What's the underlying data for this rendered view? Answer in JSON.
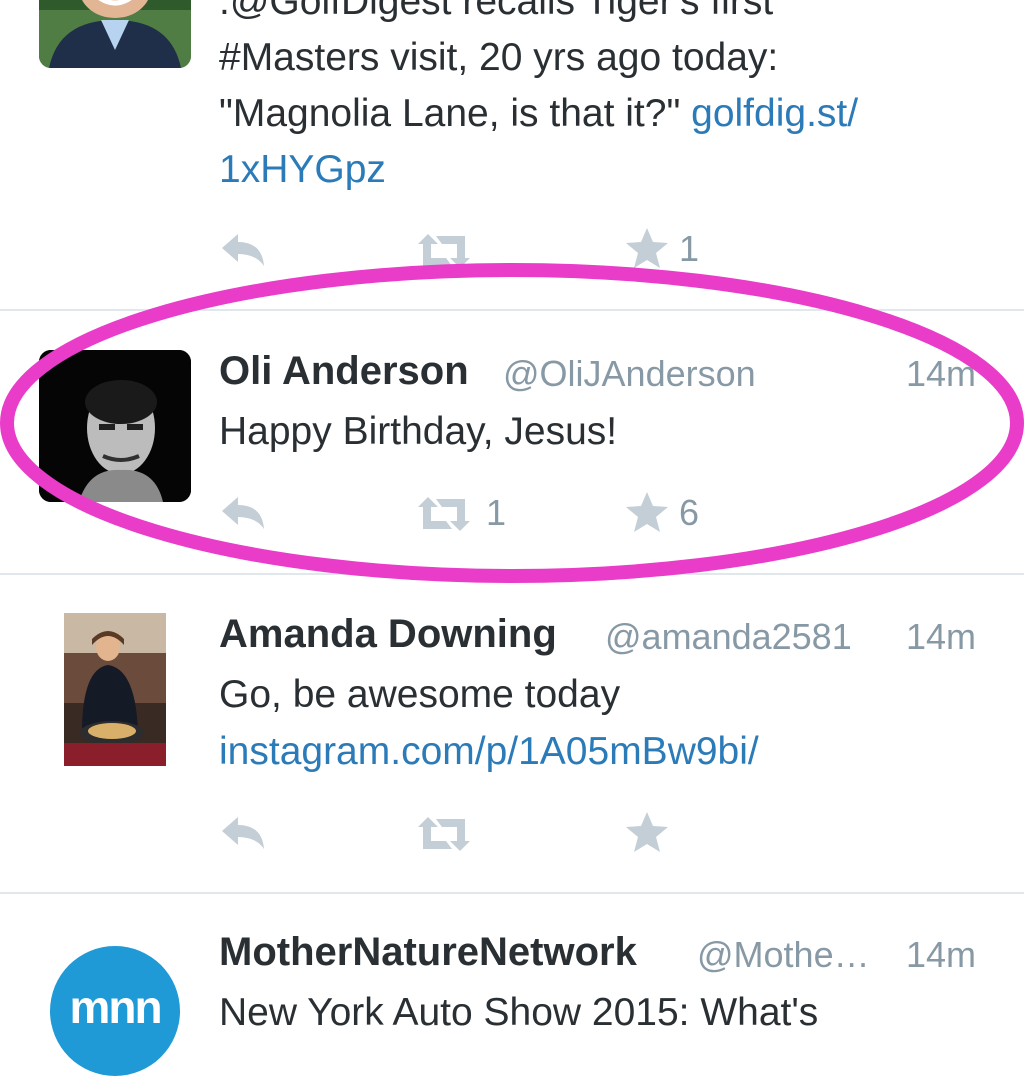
{
  "tweets": [
    {
      "avatar_name": "golf-digest-avatar",
      "lines": [
        ".@GolfDigest recalls Tiger's first",
        "#Masters visit, 20 yrs ago today:",
        "\"Magnolia Lane, is that it?\" "
      ],
      "link_inline": "golfdig.st/",
      "link_line": "1xHYGpz",
      "retweets": "",
      "favorites": "1"
    },
    {
      "name": "Oli Anderson",
      "handle": "@OliJAnderson",
      "time": "14m",
      "text": "Happy Birthday, Jesus!",
      "retweets": "1",
      "favorites": "6",
      "highlight_color": "#e93cc9"
    },
    {
      "name": "Amanda Downing",
      "handle": "@amanda2581",
      "time": "14m",
      "text": "Go, be awesome today",
      "link": "instagram.com/p/1A05mBw9bi/",
      "retweets": "",
      "favorites": ""
    },
    {
      "name": "MotherNatureNetwork",
      "handle": "@Mothe…",
      "time": "14m",
      "text": "New York Auto Show 2015: What's",
      "avatar_text": "mnn"
    }
  ],
  "colors": {
    "link": "#2b7bb9",
    "meta": "#8899a6",
    "text": "#292f33",
    "action_icon": "#c3ced6",
    "divider": "#e1e8ed",
    "mnn_blue": "#1f9ad6"
  },
  "icons": [
    "reply-icon",
    "retweet-icon",
    "favorite-star-icon"
  ]
}
